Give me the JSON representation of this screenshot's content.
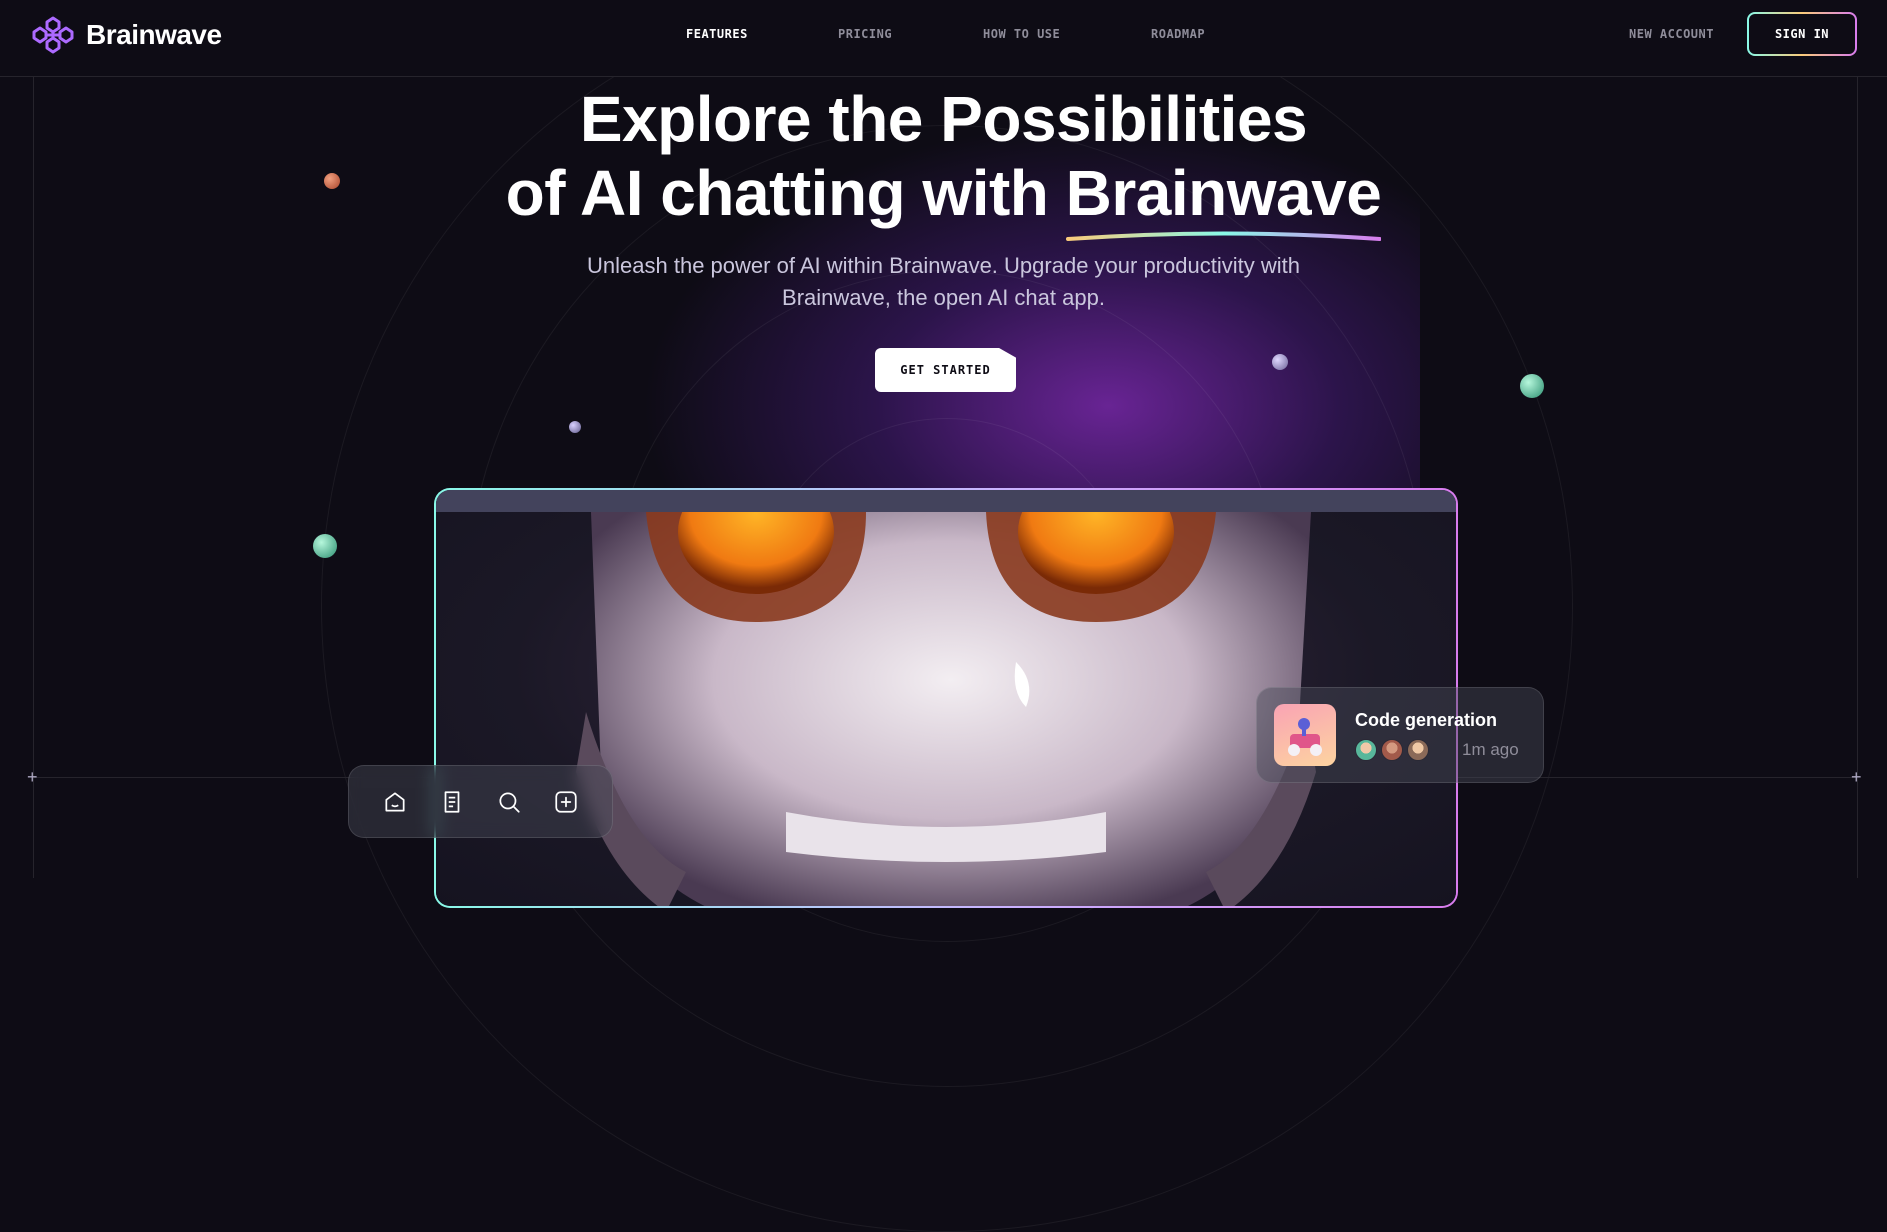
{
  "brand": {
    "name": "Brainwave",
    "accent": "#ac6aff"
  },
  "nav": {
    "items": [
      {
        "label": "FEATURES",
        "active": true
      },
      {
        "label": "PRICING",
        "active": false
      },
      {
        "label": "HOW TO USE",
        "active": false
      },
      {
        "label": "ROADMAP",
        "active": false
      }
    ],
    "new_account": "NEW ACCOUNT",
    "sign_in": "SIGN IN"
  },
  "hero": {
    "title_line1": "Explore the Possibilities",
    "title_line2_prefix": "of AI chatting with ",
    "title_highlight": "Brainwave",
    "subtitle": "Unleash the power of AI within Brainwave. Upgrade your productivity with Brainwave, the open AI chat app.",
    "cta": "GET STARTED"
  },
  "toolbar": {
    "icons": [
      "home-icon",
      "document-icon",
      "search-icon",
      "add-square-icon"
    ]
  },
  "notification": {
    "title": "Code generation",
    "time": "1m ago"
  },
  "colors": {
    "background": "#0e0c15",
    "gradient": [
      "#89f9e8",
      "#facb7b",
      "#d87cee"
    ],
    "muted_text": "#8f8d9a"
  }
}
